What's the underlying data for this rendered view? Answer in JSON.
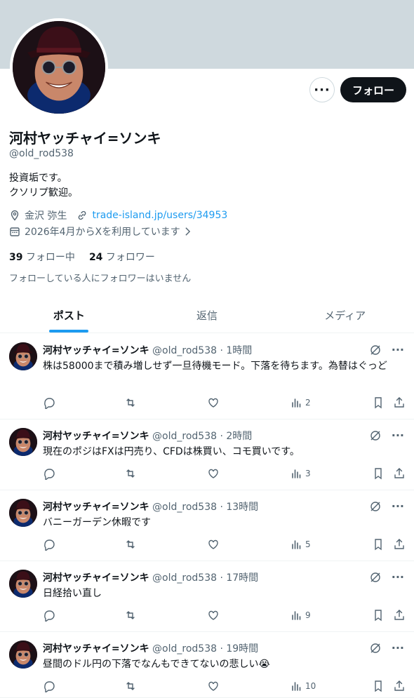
{
  "profile": {
    "display_name": "河村ヤッチャイ=ソンキ",
    "handle": "@old_rod538",
    "bio_line1": "投資垢です。",
    "bio_line2": "クソリプ歓迎。",
    "location": "金沢 弥生",
    "website": "trade-island.jp/users/34953",
    "joined": "2026年4月からXを利用しています",
    "following_count": "39",
    "following_label": "フォロー中",
    "followers_count": "24",
    "followers_label": "フォロワー",
    "mutual_note": "フォローしている人にフォロワーはいません",
    "follow_button": "フォロー",
    "more_button": "···"
  },
  "tabs": [
    {
      "label": "ポスト",
      "active": true
    },
    {
      "label": "返信",
      "active": false
    },
    {
      "label": "メディア",
      "active": false
    }
  ],
  "tweets": [
    {
      "name": "河村ヤッチャイ=ソンキ",
      "meta": "@old_rod538 · 1時間",
      "text": "株は58000まで積み増しせず一旦待機モード。下落を待ちます。為替はぐっど",
      "views": "2"
    },
    {
      "name": "河村ヤッチャイ=ソンキ",
      "meta": "@old_rod538 · 2時間",
      "text": "現在のポジはFXは円売り、CFDは株買い、コモ買いです。",
      "views": "3"
    },
    {
      "name": "河村ヤッチャイ=ソンキ",
      "meta": "@old_rod538 · 13時間",
      "text": "バニーガーデン休暇です",
      "views": "5"
    },
    {
      "name": "河村ヤッチャイ=ソンキ",
      "meta": "@old_rod538 · 17時間",
      "text": "日経拾い直し",
      "views": "9"
    },
    {
      "name": "河村ヤッチャイ=ソンキ",
      "meta": "@old_rod538 · 19時間",
      "text": "昼間のドル円の下落でなんもできてないの悲しい😭",
      "views": "10"
    }
  ],
  "colors": {
    "accent": "#1d9bf0",
    "text": "#0f1419",
    "muted": "#536471",
    "banner": "#cfd9de"
  }
}
